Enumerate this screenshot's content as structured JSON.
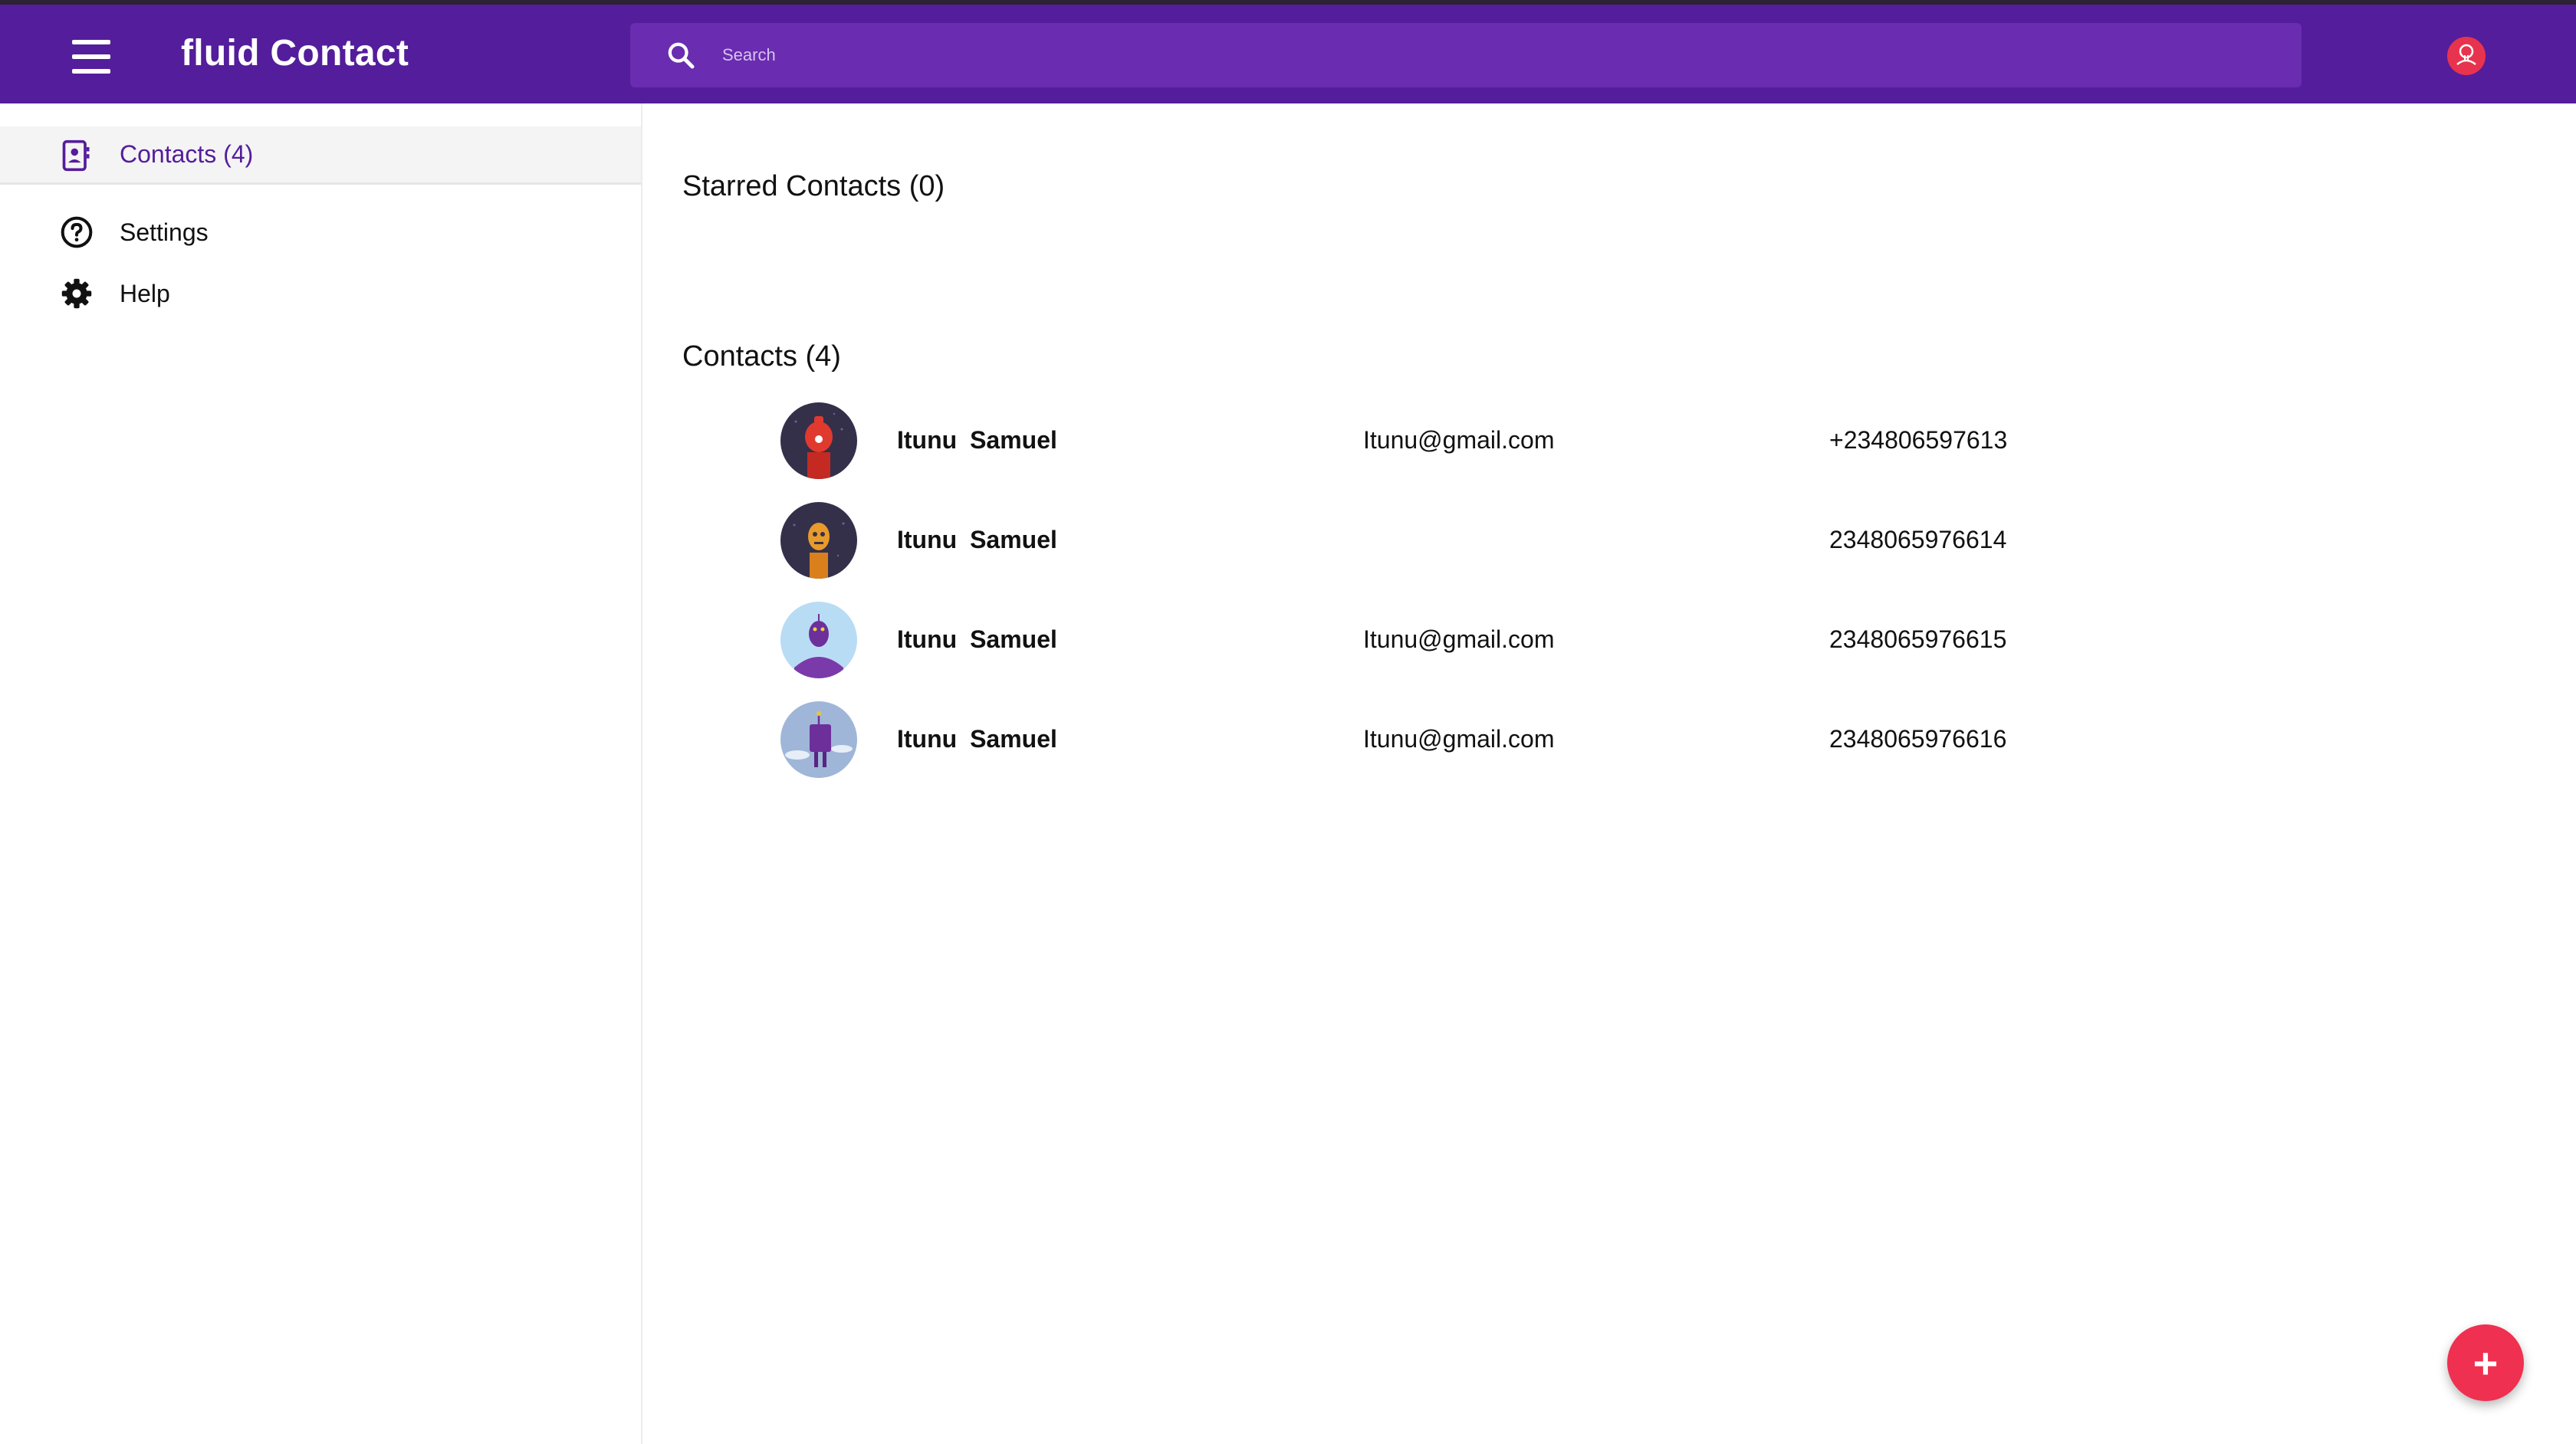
{
  "app": {
    "title": "fluid Contact"
  },
  "search": {
    "placeholder": "Search"
  },
  "sidebar": {
    "items": [
      {
        "label": "Contacts (4)",
        "icon": "contacts-icon",
        "active": true
      },
      {
        "label": "Settings",
        "icon": "help-circle-icon"
      },
      {
        "label": "Help",
        "icon": "gear-icon"
      }
    ]
  },
  "main": {
    "starred_title": "Starred Contacts (0)",
    "contacts_title": "Contacts (4)",
    "contacts": [
      {
        "name": "Itunu  Samuel",
        "email": "Itunu@gmail.com",
        "phone": "+234806597613",
        "avatar": "robot-red-avatar"
      },
      {
        "name": "Itunu  Samuel",
        "email": "",
        "phone": "2348065976614",
        "avatar": "robot-orange-avatar"
      },
      {
        "name": "Itunu  Samuel",
        "email": "Itunu@gmail.com",
        "phone": "2348065976615",
        "avatar": "robot-purple-avatar"
      },
      {
        "name": "Itunu  Samuel",
        "email": "Itunu@gmail.com",
        "phone": "2348065976616",
        "avatar": "robot-box-avatar"
      }
    ]
  },
  "fab": {
    "label": "+"
  },
  "colors": {
    "primary": "#541d9b",
    "accent": "#ef3050",
    "search_bg": "#6a2cb0"
  }
}
